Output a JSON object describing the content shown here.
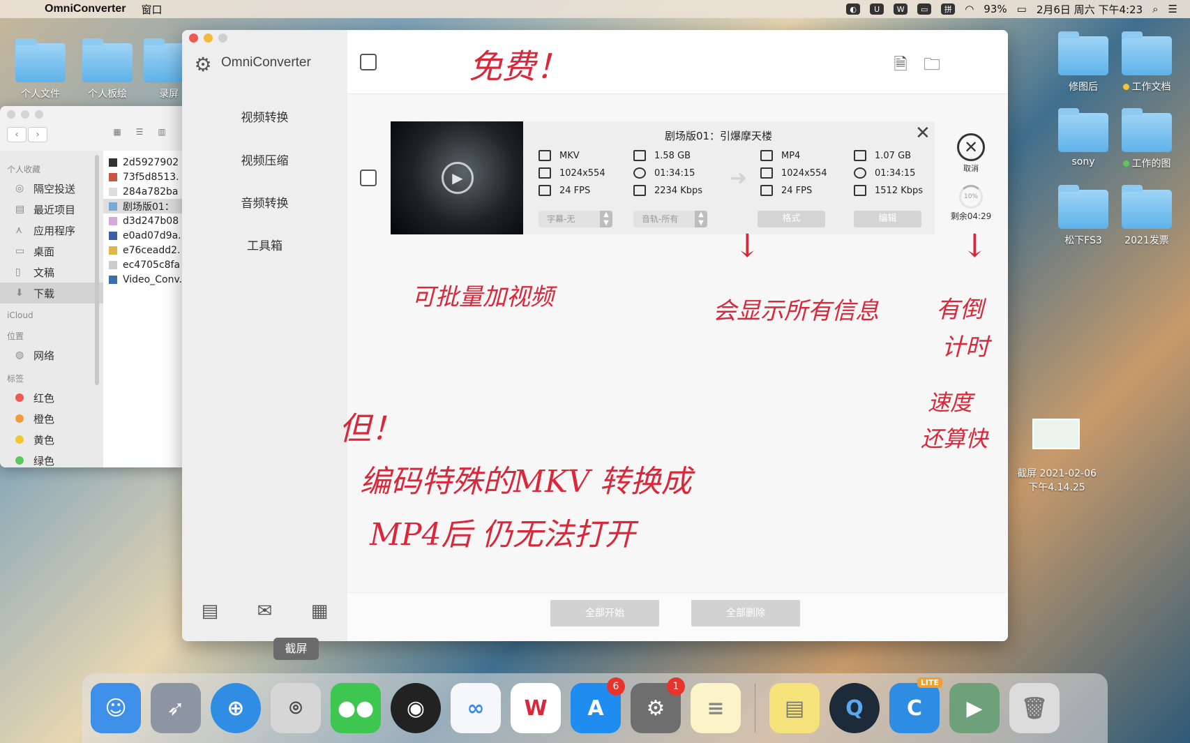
{
  "menubar": {
    "apple": "",
    "app_name": "OmniConverter",
    "menus": [
      "窗口"
    ],
    "right": {
      "battery": "93%",
      "datetime": "2月6日 周六 下午4:23",
      "input_method": "拼"
    }
  },
  "desktop": {
    "left_icons": [
      "个人文件",
      "个人板绘",
      "录屏"
    ],
    "right_icons": [
      {
        "label": "修图后",
        "tag": ""
      },
      {
        "label": "工作文档",
        "tag": "#f2c531"
      },
      {
        "label": "sony",
        "tag": ""
      },
      {
        "label": "工作的图",
        "tag": "#5cc95c"
      },
      {
        "label": "松下FS3",
        "tag": ""
      },
      {
        "label": "2021发票",
        "tag": ""
      }
    ],
    "screenshot_file": {
      "line1": "截屏 2021-02-06",
      "line2": "下午4.14.25"
    }
  },
  "finder": {
    "sections": {
      "favorites": "个人收藏",
      "icloud": "iCloud",
      "locations": "位置",
      "tags": "标签"
    },
    "favorites": [
      "隔空投送",
      "最近项目",
      "应用程序",
      "桌面",
      "文稿",
      "下载"
    ],
    "selected_favorite": "下载",
    "locations": [
      "网络"
    ],
    "tags": [
      {
        "label": "红色",
        "color": "#ee5a52"
      },
      {
        "label": "橙色",
        "color": "#f29b3a"
      },
      {
        "label": "黄色",
        "color": "#f2c531"
      },
      {
        "label": "绿色",
        "color": "#5cc95c"
      }
    ],
    "files": [
      "2d5927902",
      "73f5d8513.",
      "284a782ba",
      "剧场版01：",
      "d3d247b08",
      "e0ad07d9a.",
      "e76ceadd2.",
      "ec4705c8fa",
      "Video_Conv."
    ]
  },
  "app": {
    "brand": "OmniConverter",
    "nav": [
      "视频转换",
      "视频压缩",
      "音频转换",
      "工具箱"
    ],
    "task": {
      "title": "剧场版01：引爆摩天楼",
      "source": {
        "format": "MKV",
        "resolution": "1024x554",
        "fps": "24 FPS",
        "size": "1.58 GB",
        "duration": "01:34:15",
        "bitrate": "2234 Kbps"
      },
      "target": {
        "format": "MP4",
        "resolution": "1024x554",
        "fps": "24 FPS",
        "size": "1.07 GB",
        "duration": "01:34:15",
        "bitrate": "1512 Kbps"
      },
      "subtitle_select": "字幕-无",
      "audio_select": "音轨-所有",
      "format_button": "格式",
      "edit_button": "编辑",
      "cancel_label": "取消",
      "progress_percent": 10,
      "progress_text": "10%",
      "remaining": "剩余04:29"
    },
    "footer": {
      "start_all": "全部开始",
      "delete_all": "全部删除"
    }
  },
  "annotations": {
    "free": "免费！",
    "batch": "可批量加视频",
    "show_info": "会显示所有信息",
    "countdown_1": "有倒",
    "countdown_2": "计时",
    "speed_1": "速度",
    "speed_2": "还算快",
    "but": "但！",
    "issue_1": "编码特殊的MKV 转换成",
    "issue_2": "MP4后 仍无法打开"
  },
  "tooltip": "截屏",
  "dock": {
    "apps": [
      {
        "name": "finder",
        "color": "#3d8fe8",
        "glyph": "☺"
      },
      {
        "name": "launchpad",
        "color": "#8c96a3",
        "glyph": "🚀"
      },
      {
        "name": "safari",
        "color": "#2f8de4",
        "glyph": "⊕"
      },
      {
        "name": "screenshot",
        "color": "#c9c9c9",
        "glyph": "⌾"
      },
      {
        "name": "wechat",
        "color": "#3dc650",
        "glyph": "●●"
      },
      {
        "name": "qq",
        "color": "#222222",
        "glyph": "◉"
      },
      {
        "name": "baidu-netdisk",
        "color": "#f5f7fb",
        "glyph": "∞"
      },
      {
        "name": "wps",
        "color": "#ffffff",
        "glyph": "W"
      },
      {
        "name": "app-store",
        "color": "#1f8cf0",
        "glyph": "A",
        "badge": "6"
      },
      {
        "name": "system-preferences",
        "color": "#6e6e6e",
        "glyph": "⚙",
        "badge": "1"
      },
      {
        "name": "notes",
        "color": "#fbf4c9",
        "glyph": "≡"
      },
      {
        "name": "stickies",
        "color": "#f6e27a",
        "glyph": "▤"
      },
      {
        "name": "quicktime",
        "color": "#1d2a3a",
        "glyph": "Q"
      },
      {
        "name": "converter-lite",
        "color": "#2e8de2",
        "glyph": "C",
        "lite": "LITE"
      },
      {
        "name": "video-converter",
        "color": "#6ea07a",
        "glyph": "▶"
      },
      {
        "name": "trash",
        "color": "#dcdcdc",
        "glyph": "🗑"
      }
    ]
  }
}
